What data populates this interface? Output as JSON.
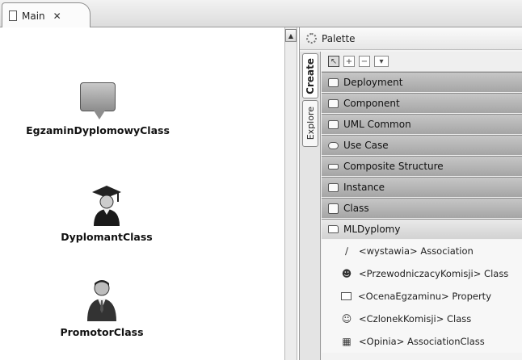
{
  "editor": {
    "tab_label": "Main",
    "tab_close": "✕"
  },
  "canvas": {
    "nodes": [
      {
        "label": "EgzaminDyplomowyClass",
        "icon": "comment-bubble-icon"
      },
      {
        "label": "DyplomantClass",
        "icon": "graduate-icon"
      },
      {
        "label": "PromotorClass",
        "icon": "businessman-icon"
      }
    ]
  },
  "palette": {
    "title": "Palette",
    "tabs": {
      "create": "Create",
      "explore": "Explore"
    },
    "tools": [
      "select-arrow-icon",
      "zoom-in-icon",
      "zoom-out-icon",
      "note-dropdown-icon"
    ],
    "drawers": [
      {
        "label": "Deployment",
        "icon": "box-icon"
      },
      {
        "label": "Component",
        "icon": "component-icon"
      },
      {
        "label": "UML Common",
        "icon": "package-icon"
      },
      {
        "label": "Use Case",
        "icon": "ellipse-icon"
      },
      {
        "label": "Composite Structure",
        "icon": "rectangle-icon"
      },
      {
        "label": "Instance",
        "icon": "instance-icon"
      },
      {
        "label": "Class",
        "icon": "class-icon"
      },
      {
        "label": "MLDyplomy",
        "icon": "folder-open-icon",
        "expanded": true
      }
    ],
    "entries": [
      {
        "label": "<wystawia> Association",
        "icon": "association-line-icon"
      },
      {
        "label": "<PrzewodniczacyKomisji> Class",
        "icon": "person-icon"
      },
      {
        "label": "<OcenaEgzaminu> Property",
        "icon": "property-icon"
      },
      {
        "label": "<CzlonekKomisji> Class",
        "icon": "group-icon"
      },
      {
        "label": "<Opinia> AssociationClass",
        "icon": "association-class-icon"
      }
    ]
  }
}
